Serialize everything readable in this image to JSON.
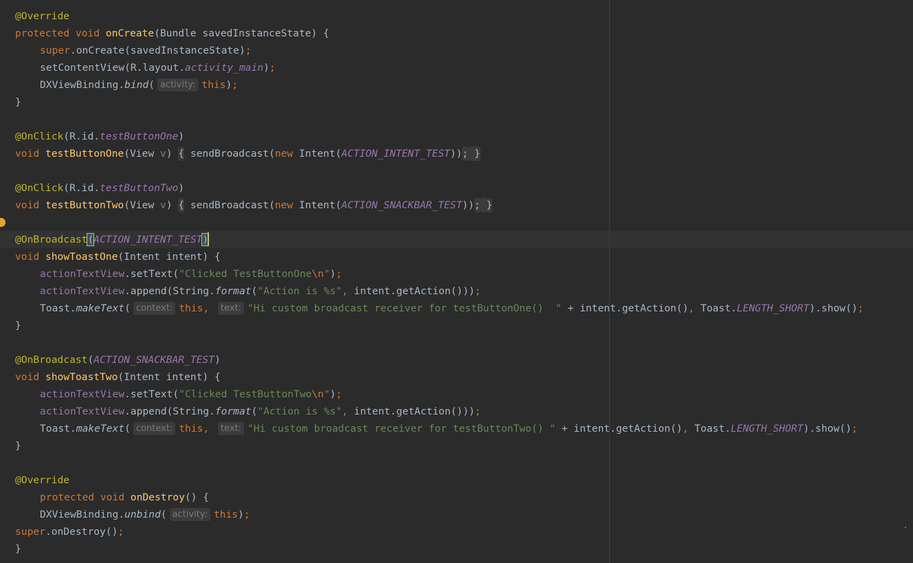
{
  "editor": {
    "language": "java",
    "colors": {
      "background": "#2b2b2b",
      "caret_row": "#323232",
      "annotation": "#bbb529",
      "keyword": "#cc7832",
      "method": "#ffc66d",
      "field": "#9876aa",
      "string": "#6a8759",
      "text": "#a9b7c6"
    },
    "icons": {
      "intention_bulb": "bulb-icon",
      "error_stripe": "error-marker"
    },
    "lines": [
      [
        {
          "c": "ann",
          "t": "@Override"
        }
      ],
      [
        {
          "c": "kw",
          "t": "protected void "
        },
        {
          "c": "fn",
          "t": "onCreate"
        },
        {
          "t": "(Bundle savedInstanceState) {"
        }
      ],
      [
        {
          "c": "kw",
          "t": "super"
        },
        {
          "t": ".onCreate(savedInstanceState)"
        },
        {
          "c": "kw",
          "t": ";"
        }
      ],
      [
        {
          "t": "setContentView(R.layout."
        },
        {
          "c": "cst",
          "t": "activity_main"
        },
        {
          "t": ")"
        },
        {
          "c": "kw",
          "t": ";"
        }
      ],
      [
        {
          "t": "DXViewBinding."
        },
        {
          "c": "it",
          "t": "bind"
        },
        {
          "t": "("
        },
        {
          "hint": "activity:"
        },
        {
          "c": "kw",
          "t": "this"
        },
        {
          "t": ")"
        },
        {
          "c": "kw",
          "t": ";"
        }
      ],
      [
        {
          "t": "}"
        }
      ],
      [
        {
          "t": ""
        }
      ],
      [
        {
          "c": "ann",
          "t": "@OnClick"
        },
        {
          "t": "(R.id."
        },
        {
          "c": "cst",
          "t": "testButtonOne"
        },
        {
          "t": ")"
        }
      ],
      [
        {
          "c": "kw",
          "t": "void "
        },
        {
          "c": "fn",
          "t": "testButtonOne"
        },
        {
          "t": "(View "
        },
        {
          "c": "prm",
          "t": "v"
        },
        {
          "t": ") "
        },
        {
          "fold": "{"
        },
        {
          "t": " sendBroadcast("
        },
        {
          "c": "kw",
          "t": "new "
        },
        {
          "t": "Intent("
        },
        {
          "c": "cst",
          "t": "ACTION_INTENT_TEST"
        },
        {
          "t": "))"
        },
        {
          "foldkw": ";"
        },
        {
          "fold": " }"
        }
      ],
      [
        {
          "t": ""
        }
      ],
      [
        {
          "c": "ann",
          "t": "@OnClick"
        },
        {
          "t": "(R.id."
        },
        {
          "c": "cst",
          "t": "testButtonTwo"
        },
        {
          "t": ")"
        }
      ],
      [
        {
          "c": "kw",
          "t": "void "
        },
        {
          "c": "fn",
          "t": "testButtonTwo"
        },
        {
          "t": "(View "
        },
        {
          "c": "prm",
          "t": "v"
        },
        {
          "t": ") "
        },
        {
          "fold": "{"
        },
        {
          "t": " sendBroadcast("
        },
        {
          "c": "kw",
          "t": "new "
        },
        {
          "t": "Intent("
        },
        {
          "c": "cst",
          "t": "ACTION_SNACKBAR_TEST"
        },
        {
          "t": "))"
        },
        {
          "foldkw": ";"
        },
        {
          "fold": " }"
        }
      ],
      [
        {
          "t": ""
        }
      ],
      [
        {
          "c": "ann",
          "t": "@OnBroadcast"
        },
        {
          "bm": "("
        },
        {
          "c": "cst",
          "t": "ACTION_INTENT_TEST"
        },
        {
          "bm": ")"
        },
        {
          "caret": true
        }
      ],
      [
        {
          "c": "kw",
          "t": "void "
        },
        {
          "c": "fn",
          "t": "showToastOne"
        },
        {
          "t": "(Intent intent) {"
        }
      ],
      [
        {
          "c": "fld",
          "t": "actionTextView"
        },
        {
          "t": ".setText("
        },
        {
          "c": "str",
          "t": "\"Clicked TestButtonOne"
        },
        {
          "c": "esc",
          "t": "\\n"
        },
        {
          "c": "str",
          "t": "\""
        },
        {
          "t": ")"
        },
        {
          "c": "kw",
          "t": ";"
        }
      ],
      [
        {
          "c": "fld",
          "t": "actionTextView"
        },
        {
          "t": ".append(String."
        },
        {
          "c": "it",
          "t": "format"
        },
        {
          "t": "("
        },
        {
          "c": "str",
          "t": "\"Action is %s\""
        },
        {
          "c": "kw",
          "t": ", "
        },
        {
          "t": "intent.getAction()))"
        },
        {
          "c": "kw",
          "t": ";"
        }
      ],
      [
        {
          "t": "Toast."
        },
        {
          "c": "it",
          "t": "makeText"
        },
        {
          "t": "("
        },
        {
          "hint": "context:"
        },
        {
          "c": "kw",
          "t": "this, "
        },
        {
          "hint": "text:"
        },
        {
          "c": "str",
          "t": "\"Hi custom broadcast receiver for testButtonOne()  \""
        },
        {
          "t": " + intent.getAction()"
        },
        {
          "c": "kw",
          "t": ", "
        },
        {
          "t": "Toast."
        },
        {
          "c": "cst",
          "t": "LENGTH_SHORT"
        },
        {
          "t": ").show()"
        },
        {
          "c": "kw",
          "t": ";"
        }
      ],
      [
        {
          "t": "}"
        }
      ],
      [
        {
          "t": ""
        }
      ],
      [
        {
          "c": "ann",
          "t": "@OnBroadcast"
        },
        {
          "t": "("
        },
        {
          "c": "cst",
          "t": "ACTION_SNACKBAR_TEST"
        },
        {
          "t": ")"
        }
      ],
      [
        {
          "c": "kw",
          "t": "void "
        },
        {
          "c": "fn",
          "t": "showToastTwo"
        },
        {
          "t": "(Intent intent) {"
        }
      ],
      [
        {
          "c": "fld",
          "t": "actionTextView"
        },
        {
          "t": ".setText("
        },
        {
          "c": "str",
          "t": "\"Clicked TestButtonTwo"
        },
        {
          "c": "esc",
          "t": "\\n"
        },
        {
          "c": "str",
          "t": "\""
        },
        {
          "t": ")"
        },
        {
          "c": "kw",
          "t": ";"
        }
      ],
      [
        {
          "c": "fld",
          "t": "actionTextView"
        },
        {
          "t": ".append(String."
        },
        {
          "c": "it",
          "t": "format"
        },
        {
          "t": "("
        },
        {
          "c": "str",
          "t": "\"Action is %s\""
        },
        {
          "c": "kw",
          "t": ", "
        },
        {
          "t": "intent.getAction()))"
        },
        {
          "c": "kw",
          "t": ";"
        }
      ],
      [
        {
          "t": "Toast."
        },
        {
          "c": "it",
          "t": "makeText"
        },
        {
          "t": "("
        },
        {
          "hint": "context:"
        },
        {
          "c": "kw",
          "t": "this, "
        },
        {
          "hint": "text:"
        },
        {
          "c": "str",
          "t": "\"Hi custom broadcast receiver for testButtonTwo() \""
        },
        {
          "t": " + intent.getAction()"
        },
        {
          "c": "kw",
          "t": ", "
        },
        {
          "t": "Toast."
        },
        {
          "c": "cst",
          "t": "LENGTH_SHORT"
        },
        {
          "t": ").show()"
        },
        {
          "c": "kw",
          "t": ";"
        }
      ],
      [
        {
          "t": "}"
        }
      ],
      [
        {
          "t": ""
        }
      ],
      [
        {
          "c": "ann",
          "t": "@Override"
        }
      ],
      [
        {
          "c": "kw",
          "t": "protected void "
        },
        {
          "c": "fn",
          "t": "onDestroy"
        },
        {
          "t": "() {"
        }
      ],
      [
        {
          "t": "DXViewBinding."
        },
        {
          "c": "it",
          "t": "unbind"
        },
        {
          "t": "("
        },
        {
          "hint": "activity:"
        },
        {
          "c": "kw",
          "t": "this"
        },
        {
          "t": ")"
        },
        {
          "c": "kw",
          "t": ";"
        }
      ],
      [
        {
          "c": "kw",
          "t": "super"
        },
        {
          "t": ".onDestroy()"
        },
        {
          "c": "kw",
          "t": ";"
        }
      ],
      [
        {
          "t": "}"
        }
      ]
    ]
  }
}
